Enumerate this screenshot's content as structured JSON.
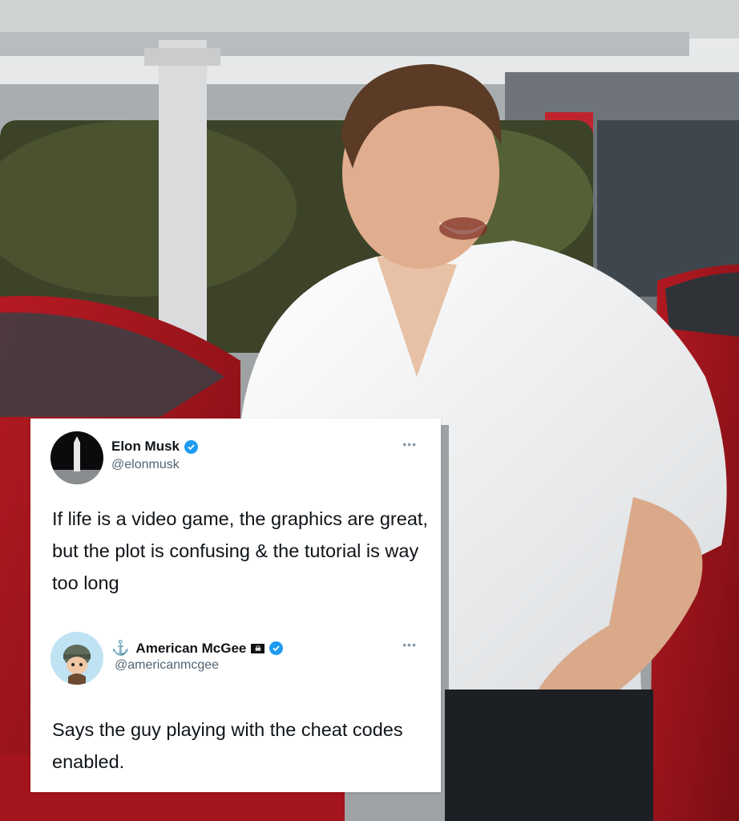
{
  "tweet": {
    "author": "Elon Musk",
    "handle": "@elonmusk",
    "text": "If life is a video game, the graphics are great, but the plot is confusing & the tutorial is way too long",
    "more_label": "•••"
  },
  "reply": {
    "anchor_glyph": "⚓",
    "author": "American McGee",
    "flag_glyph": "☠",
    "handle": "@americanmcgee",
    "text": "Says the guy playing with the cheat codes enabled.",
    "more_label": "•••"
  },
  "colors": {
    "verified": "#1d9bf0",
    "handle": "#536471",
    "text": "#0f1419"
  }
}
